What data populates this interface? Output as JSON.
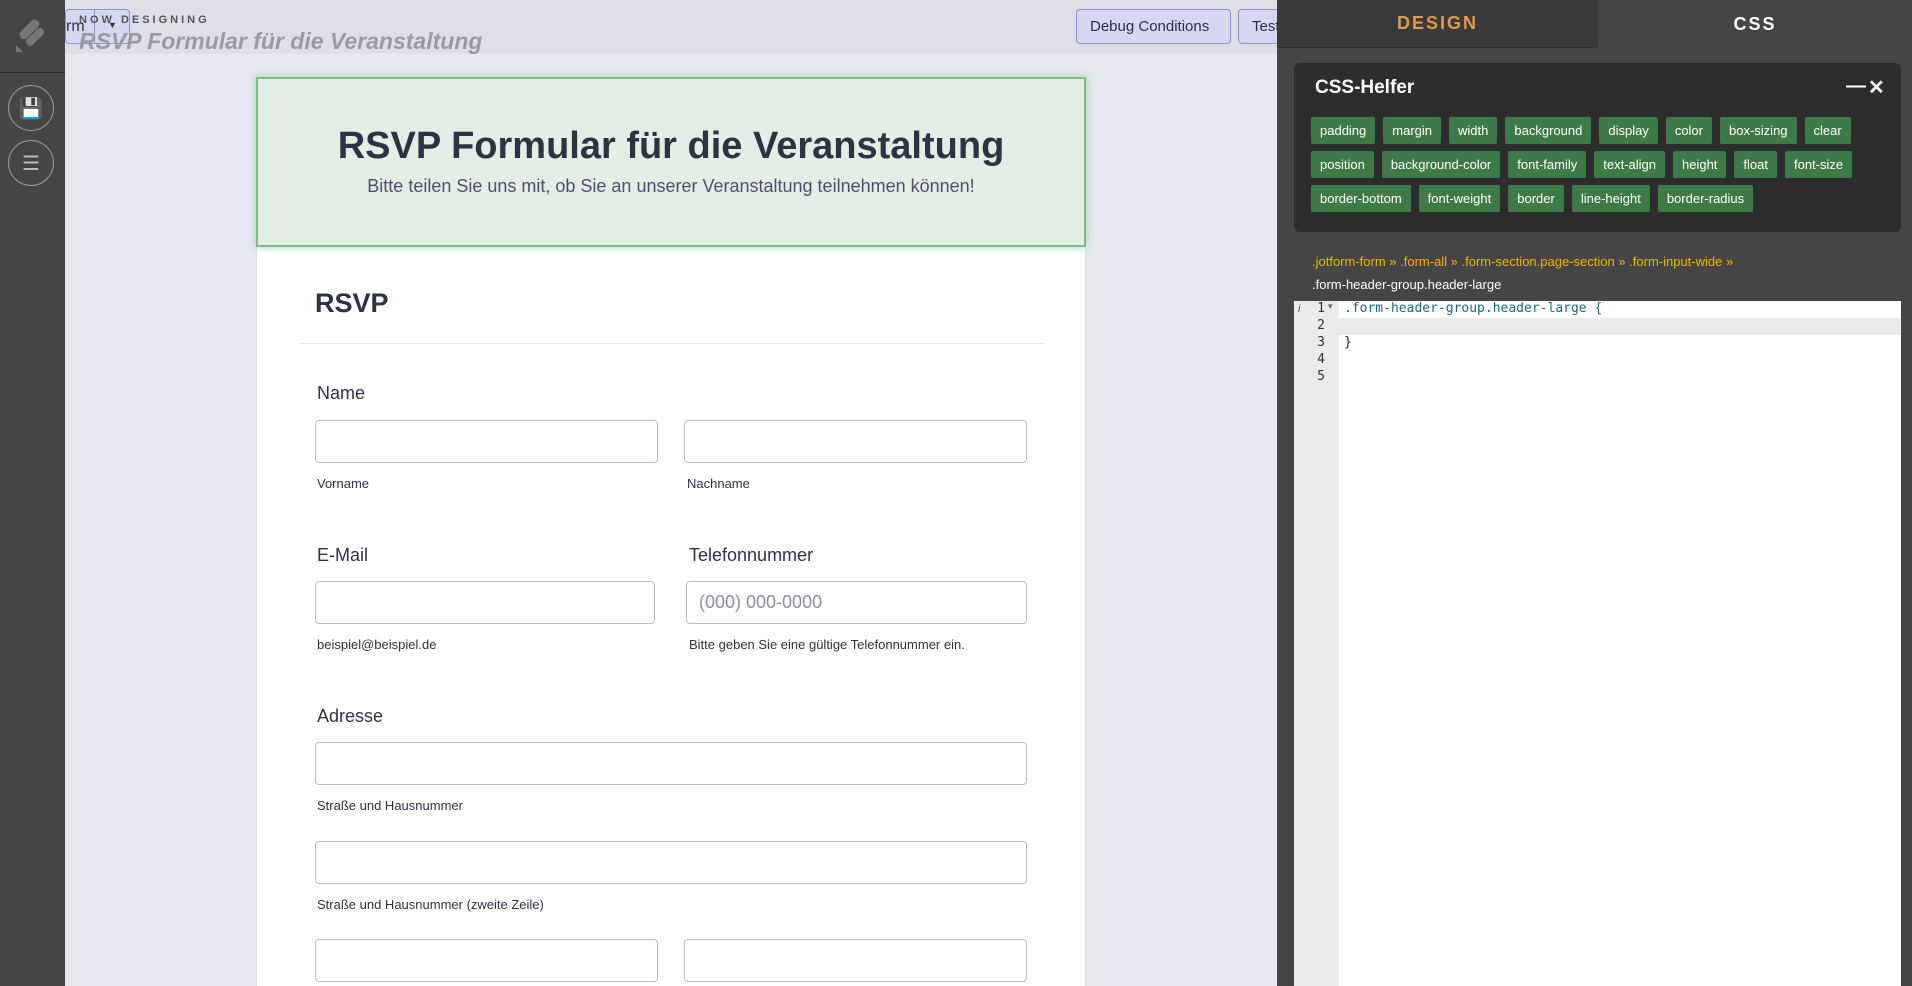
{
  "header": {
    "now_designing": "NOW DESIGNING",
    "form_title": "RSVP Formular für die Veranstaltung",
    "left_fragment": "rm",
    "debug_button": "Debug Conditions",
    "test_button": "Test"
  },
  "sidebar": {
    "icons": [
      "logo-icon",
      "save-icon",
      "menu-icon"
    ]
  },
  "form": {
    "title": "RSVP Formular für die Veranstaltung",
    "subtitle": "Bitte teilen Sie uns mit, ob Sie an unserer Veranstaltung teilnehmen können!",
    "section": "RSVP",
    "name_label": "Name",
    "first": "Vorname",
    "last": "Nachname",
    "email_label": "E-Mail",
    "email_sub": "beispiel@beispiel.de",
    "phone_label": "Telefonnummer",
    "phone_placeholder": "(000) 000-0000",
    "phone_sub": "Bitte geben Sie eine gültige Telefonnummer ein.",
    "address_label": "Adresse",
    "street1": "Straße und Hausnummer",
    "street2": "Straße und Hausnummer (zweite Zeile)"
  },
  "panel": {
    "tabs": [
      "DESIGN",
      "CSS"
    ],
    "helper_title": "CSS-Helfer",
    "chips": [
      "padding",
      "margin",
      "width",
      "background",
      "display",
      "color",
      "box-sizing",
      "clear",
      "position",
      "background-color",
      "font-family",
      "text-align",
      "height",
      "float",
      "font-size",
      "border-bottom",
      "font-weight",
      "border",
      "line-height",
      "border-radius"
    ],
    "breadcrumb": ".jotform-form » .form-all » .form-section.page-section » .form-input-wide »",
    "selector": ".form-header-group.header-large",
    "code_lines": [
      ".form-header-group.header-large {",
      "",
      "}",
      "",
      ""
    ],
    "line_numbers": [
      "1",
      "2",
      "3",
      "4",
      "5"
    ]
  },
  "colors": {
    "chip": "#3e7a48",
    "design_tab": "#e09a4e",
    "breadcrumb": "#f0b400"
  }
}
